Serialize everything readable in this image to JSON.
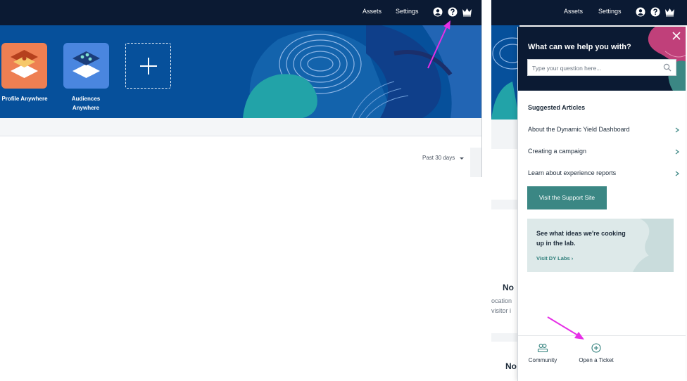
{
  "left_window": {
    "topbar": {
      "assets_label": "Assets",
      "settings_label": "Settings",
      "icons": [
        "user-circle-icon",
        "help-circle-icon",
        "crown-icon"
      ]
    },
    "tiles": [
      {
        "label_line1": "Profile Anywhere",
        "label_line2": "",
        "icon": "profile-anywhere-icon",
        "color": "#ee7f52"
      },
      {
        "label_line1": "Audiences",
        "label_line2": "Anywhere",
        "icon": "audiences-anywhere-icon",
        "color": "#4a86df"
      },
      {
        "label_line1": "",
        "label_line2": "",
        "icon": "plus-icon"
      }
    ],
    "date_filter": "Past 30 days"
  },
  "right_window": {
    "topbar": {
      "assets_label": "Assets",
      "settings_label": "Settings"
    },
    "background_fragments": {
      "heading_1": "No",
      "line_1": "ocation",
      "line_2": "visitor i",
      "heading_2": "No"
    },
    "help_panel": {
      "title": "What can we help you with?",
      "search_placeholder": "Type your question here...",
      "suggested_title": "Suggested Articles",
      "articles": [
        "About the Dynamic Yield Dashboard",
        "Creating a campaign",
        "Learn about experience reports"
      ],
      "support_button": "Visit the Support Site",
      "labs_card": {
        "text": "See what ideas we're cooking up in the lab.",
        "link": "Visit DY Labs ›"
      },
      "footer": {
        "community_label": "Community",
        "ticket_label": "Open a Ticket"
      }
    }
  },
  "colors": {
    "nav_dark": "#0b1a33",
    "hero_blue": "#06509b",
    "teal_button": "#3b8784",
    "annotation_arrow": "#e62ee6"
  }
}
